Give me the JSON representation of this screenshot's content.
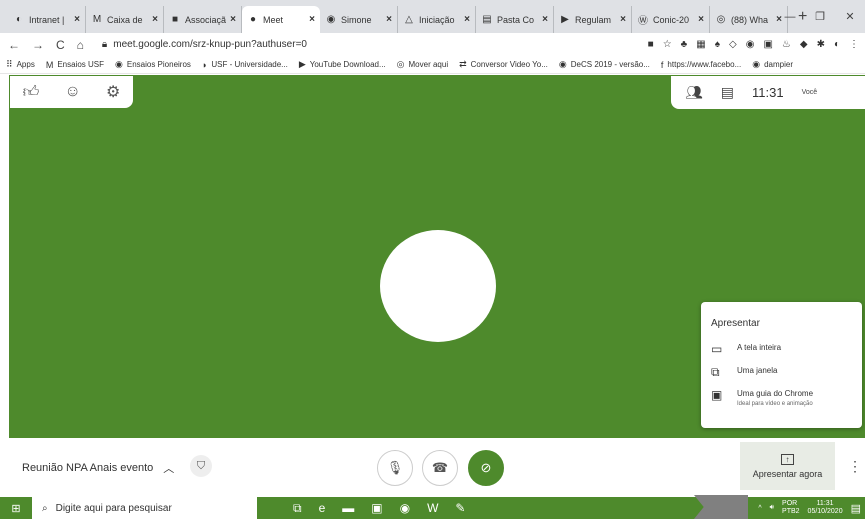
{
  "browser": {
    "tabs": [
      {
        "icon": "globe-icon",
        "glyph": "◐",
        "title": "Intranet |"
      },
      {
        "icon": "gmail-icon",
        "glyph": "M",
        "title": "Caixa de"
      },
      {
        "icon": "sheet-icon",
        "glyph": "■",
        "title": "Associaçã"
      },
      {
        "icon": "meet-icon",
        "glyph": "●",
        "title": "Meet",
        "active": true
      },
      {
        "icon": "location-icon",
        "glyph": "◉",
        "title": "Simone"
      },
      {
        "icon": "drive-icon",
        "glyph": "△",
        "title": "Iniciação"
      },
      {
        "icon": "docs-icon",
        "glyph": "▤",
        "title": "Pasta Co"
      },
      {
        "icon": "play-icon",
        "glyph": "▶",
        "title": "Regulam"
      },
      {
        "icon": "wordpress-icon",
        "glyph": "Ⓦ",
        "title": "Conic-20"
      },
      {
        "icon": "whatsapp-icon",
        "glyph": "◎",
        "title": "(88) Wha"
      }
    ],
    "tab_close": "×",
    "new_tab": "+",
    "url": "meet.google.com/srz-knup-pun?authuser=0",
    "bookmarks": [
      {
        "icon": "apps-icon",
        "glyph": "⠿",
        "label": "Apps"
      },
      {
        "icon": "gmail-icon",
        "glyph": "M",
        "label": "Ensaios USF"
      },
      {
        "icon": "chrome-icon",
        "glyph": "◉",
        "label": "Ensaios Pioneiros"
      },
      {
        "icon": "link-icon",
        "glyph": "◗",
        "label": "USF - Universidade..."
      },
      {
        "icon": "youtube-icon",
        "glyph": "▶",
        "label": "YouTube Download..."
      },
      {
        "icon": "globe-icon",
        "glyph": "◎",
        "label": "Mover aqui"
      },
      {
        "icon": "converter-icon",
        "glyph": "⇄",
        "label": "Conversor Video Yo..."
      },
      {
        "icon": "chrome-icon",
        "glyph": "◉",
        "label": "DeCS 2019 - versão..."
      },
      {
        "icon": "facebook-icon",
        "glyph": "f",
        "label": "https://www.facebo..."
      },
      {
        "icon": "chrome-icon",
        "glyph": "◉",
        "label": "dampier"
      }
    ]
  },
  "meet": {
    "time": "11:31",
    "you_label": "Você",
    "meeting_name": "Reunião NPA Anais evento",
    "present_menu": {
      "title": "Apresentar",
      "options": [
        {
          "icon": "laptop-icon",
          "glyph": "▭",
          "label": "A tela inteira",
          "sub": ""
        },
        {
          "icon": "window-icon",
          "glyph": "⧉",
          "label": "Uma janela",
          "sub": ""
        },
        {
          "icon": "tab-icon",
          "glyph": "▣",
          "label": "Uma guia do Chrome",
          "sub": "Ideal para vídeo e animação"
        }
      ]
    },
    "present_now": "Apresentar agora"
  },
  "taskbar": {
    "search_placeholder": "Digite aqui para pesquisar",
    "lang": "POR",
    "lang2": "PTB2",
    "time": "11:31",
    "date": "05/10/2020"
  }
}
